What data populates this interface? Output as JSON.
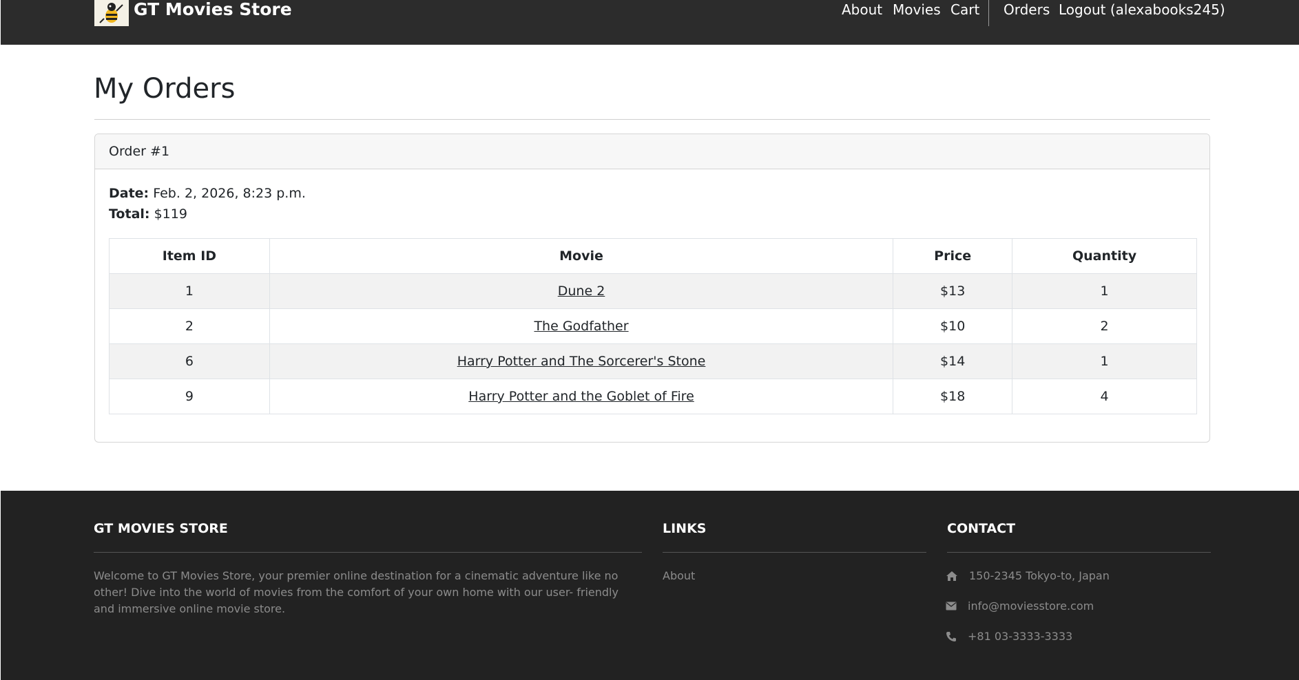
{
  "nav": {
    "brand": "GT Movies Store",
    "about": "About",
    "movies": "Movies",
    "cart": "Cart",
    "orders": "Orders",
    "logout": "Logout (alexabooks245)"
  },
  "main": {
    "title": "My Orders",
    "order": {
      "header": "Order #1",
      "date_label": "Date:",
      "date_value": "Feb. 2, 2026, 8:23 p.m.",
      "total_label": "Total:",
      "total_value": "$119",
      "columns": [
        "Item ID",
        "Movie",
        "Price",
        "Quantity"
      ],
      "rows": [
        {
          "id": "1",
          "movie": "Dune 2",
          "price": "$13",
          "qty": "1"
        },
        {
          "id": "2",
          "movie": "The Godfather",
          "price": "$10",
          "qty": "2"
        },
        {
          "id": "6",
          "movie": "Harry Potter and The Sorcerer's Stone",
          "price": "$14",
          "qty": "1"
        },
        {
          "id": "9",
          "movie": "Harry Potter and the Goblet of Fire",
          "price": "$18",
          "qty": "4"
        }
      ]
    }
  },
  "footer": {
    "about_heading": "GT MOVIES STORE",
    "about_text": "Welcome to GT Movies Store, your premier online destination for a cinematic adventure like no other! Dive into the world of movies from the comfort of your own home with our user- friendly and immersive online movie store.",
    "links_heading": "LINKS",
    "links": [
      "About"
    ],
    "contact_heading": "CONTACT",
    "address": "150-2345 Tokyo-to, Japan",
    "email": "info@moviesstore.com",
    "phone": "+81 03-3333-3333"
  },
  "icons": {
    "logo": "bee-mascot-logo",
    "address": "home-icon",
    "email": "envelope-icon",
    "phone": "phone-icon"
  },
  "colors": {
    "navbar": "#2c2c2c",
    "footer": "#222222",
    "striped_row": "#f2f2f2"
  }
}
